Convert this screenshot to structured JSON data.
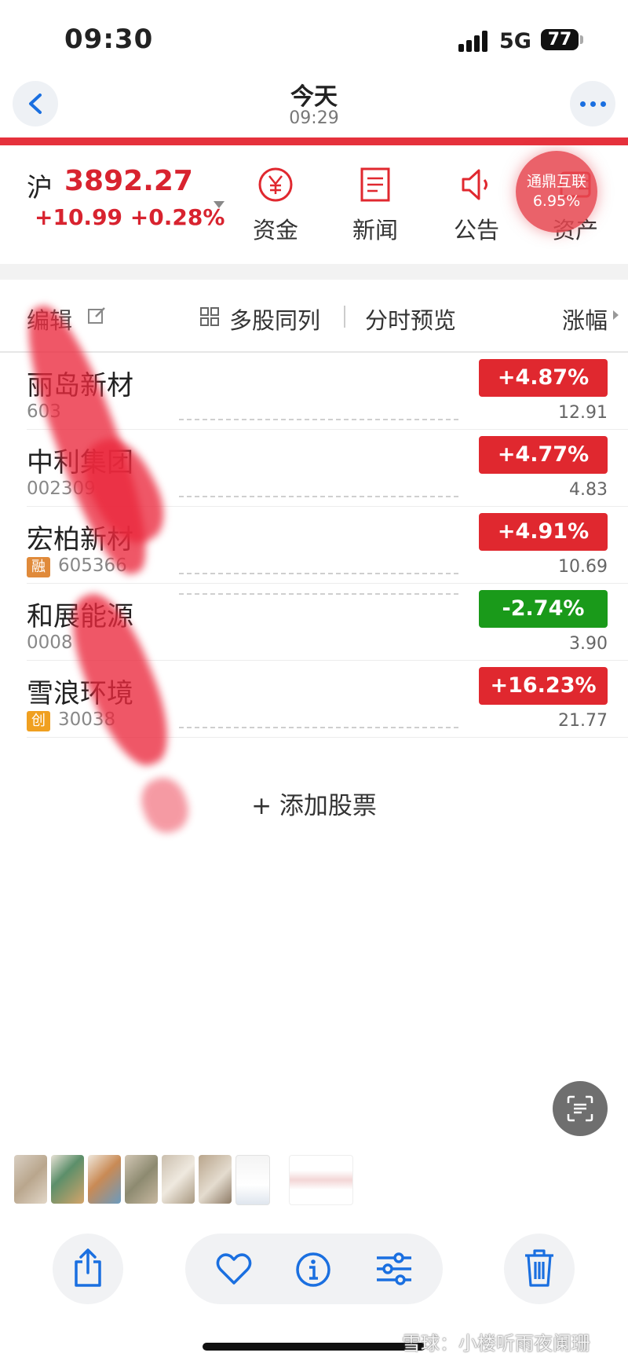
{
  "status_bar": {
    "time": "09:30",
    "network": "5G",
    "battery": "77"
  },
  "header": {
    "title": "今天",
    "subtitle": "09:29"
  },
  "index": {
    "name": "沪",
    "value": "3892.27",
    "change": "+10.99 +0.28%"
  },
  "tools": [
    {
      "label": "资金",
      "icon": "yen-circle-icon"
    },
    {
      "label": "新闻",
      "icon": "document-icon"
    },
    {
      "label": "公告",
      "icon": "speaker-icon"
    },
    {
      "label": "资产",
      "icon": "wallet-icon"
    }
  ],
  "badge": {
    "name": "通鼎互联",
    "pct": "6.95%"
  },
  "toolbar": {
    "edit": "编辑",
    "multi": "多股同列",
    "preview": "分时预览",
    "sort": "涨幅"
  },
  "stocks": [
    {
      "name": "丽岛新材",
      "code": "603",
      "tag": "",
      "pct": "+4.87%",
      "price": "12.91",
      "color": "#e0282f"
    },
    {
      "name": "中利集团",
      "code": "002309",
      "tag": "",
      "pct": "+4.77%",
      "price": "4.83",
      "color": "#e0282f"
    },
    {
      "name": "宏柏新材",
      "code": "605366",
      "tag": "融",
      "pct": "+4.91%",
      "price": "10.69",
      "color": "#e0282f"
    },
    {
      "name": "和展能源",
      "code": "0008",
      "tag": "",
      "pct": "-2.74%",
      "price": "3.90",
      "color": "#1a9a1a"
    },
    {
      "name": "雪浪环境",
      "code": "30038",
      "tag": "创",
      "pct": "+16.23%",
      "price": "21.77",
      "color": "#e0282f"
    }
  ],
  "add_stock": "+ 添加股票",
  "watermark": "雪球：小楼听雨夜阑珊",
  "colors": {
    "accent_red": "#e5313c",
    "up": "#e0282f",
    "down": "#1a9a1a",
    "ios_blue": "#1a6fe0"
  }
}
